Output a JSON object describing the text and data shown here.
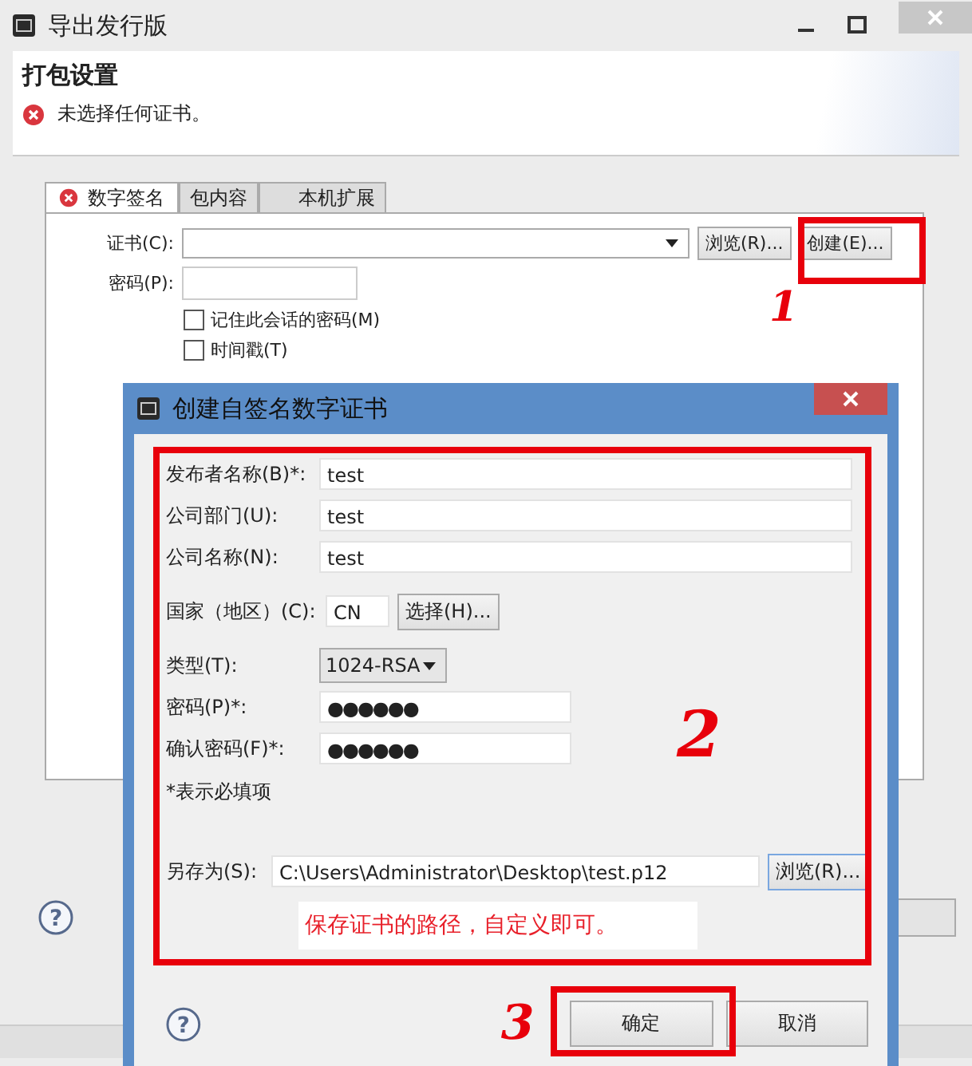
{
  "window": {
    "title": "导出发行版",
    "header_title": "打包设置",
    "error": "未选择任何证书。"
  },
  "tabs": [
    {
      "label": "数字签名",
      "selected": true,
      "error": true
    },
    {
      "label": "包内容",
      "selected": false,
      "error": false
    },
    {
      "label": "本机扩展",
      "selected": false,
      "error": false
    }
  ],
  "signature": {
    "certificate_label": "证书(C):",
    "browse": "浏览(R)...",
    "create": "创建(E)...",
    "password_label": "密码(P):",
    "checkboxes": [
      {
        "label": "记住此会话的密码(M)",
        "checked": false
      },
      {
        "label": "时间戳(T)",
        "checked": false
      }
    ]
  },
  "dialog": {
    "title": "创建自签名数字证书",
    "fields": [
      {
        "label": "发布者名称(B)*:",
        "value": "test"
      },
      {
        "label": "公司部门(U):",
        "value": "test"
      },
      {
        "label": "公司名称(N):",
        "value": "test"
      }
    ],
    "country": {
      "label": "国家（地区）(C):",
      "value": "CN",
      "button": "选择(H)..."
    },
    "type": {
      "label": "类型(T):",
      "value": "1024-RSA"
    },
    "passwords": [
      {
        "label": "密码(P)*:",
        "value": "●●●●●●"
      },
      {
        "label": "确认密码(F)*:",
        "value": "●●●●●●"
      }
    ],
    "note": "*表示必填项",
    "save_as": {
      "label": "另存为(S):",
      "value": "C:\\Users\\Administrator\\Desktop\\test.p12",
      "button": "浏览(R)..."
    },
    "buttons": [
      "确定",
      "取消"
    ]
  },
  "help_symbols": [
    "?",
    "?"
  ],
  "annotations": {
    "numbers": [
      "1",
      "2",
      "3"
    ],
    "note": "保存证书的路径，自定义即可。"
  }
}
